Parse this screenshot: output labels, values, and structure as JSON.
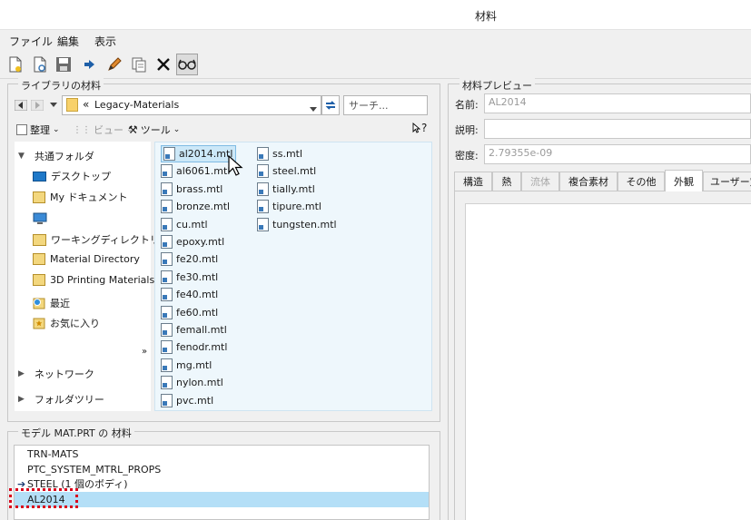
{
  "window": {
    "title": "材料"
  },
  "menu": [
    "ファイル",
    "編集",
    "表示"
  ],
  "toolbar": {
    "icons": [
      "new-file-icon",
      "open-file-icon",
      "save-icon",
      "load-arrow-icon",
      "edit-pencil-icon",
      "copy-icon",
      "delete-icon",
      "glasses-icon"
    ]
  },
  "library": {
    "group_label": "ライブラリの材料",
    "path": "Legacy-Materials",
    "path_prefix": "«",
    "search_placeholder": "サーチ...",
    "organize_label": "整理",
    "view_label": "ビュー",
    "tools_label": "ツール",
    "help_label": "?",
    "tree": {
      "favorites_header": "共通フォルダ",
      "items": [
        "デスクトップ",
        "My ドキュメント",
        "",
        "ワーキングディレクトリ",
        "Material Directory",
        "3D Printing Materials",
        "最近",
        "お気に入り"
      ],
      "more": "»",
      "network": "ネットワーク",
      "folder_tree": "フォルダツリー"
    },
    "files_col1": [
      "al2014.mtl",
      "al6061.mtl",
      "brass.mtl",
      "bronze.mtl",
      "cu.mtl",
      "epoxy.mtl",
      "fe20.mtl",
      "fe30.mtl",
      "fe40.mtl",
      "fe60.mtl",
      "femall.mtl",
      "fenodr.mtl",
      "mg.mtl",
      "nylon.mtl",
      "pvc.mtl"
    ],
    "files_col2": [
      "ss.mtl",
      "steel.mtl",
      "tially.mtl",
      "tipure.mtl",
      "tungsten.mtl"
    ],
    "selected_file": "al2014.mtl"
  },
  "model": {
    "group_label": "モデル MAT.PRT の 材料",
    "items": [
      "TRN-MATS",
      "PTC_SYSTEM_MTRL_PROPS",
      "STEEL (1 個のボディ)",
      "AL2014"
    ],
    "assigned_marker_row": "STEEL (1 個のボディ)",
    "selected": "AL2014"
  },
  "preview": {
    "group_label": "材料プレビュー",
    "name_label": "名前:",
    "name_value": "AL2014",
    "desc_label": "説明:",
    "desc_value": "",
    "density_label": "密度:",
    "density_value": "2.79355e-09",
    "tabs": [
      "構造",
      "熱",
      "流体",
      "複合素材",
      "その他",
      "外観",
      "ユーザー定"
    ],
    "active_tab": "外観",
    "disabled_tab": "流体"
  },
  "colors": {
    "selection": "#b4dff7",
    "highlight_box": "#d9001b",
    "file_panel_bg": "#eef7fc"
  }
}
